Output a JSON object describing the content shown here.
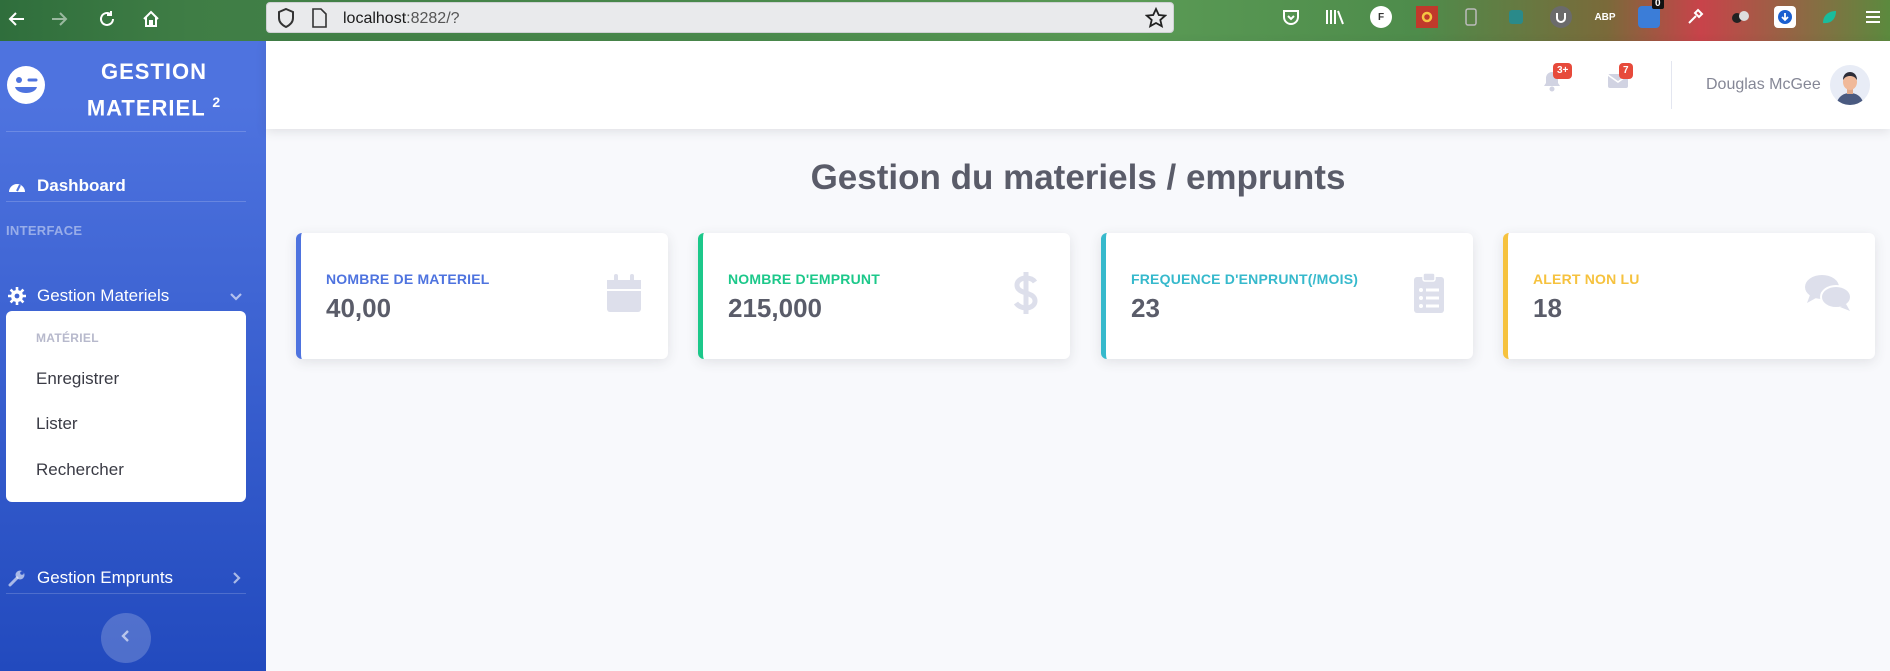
{
  "browser": {
    "url_host": "localhost",
    "url_rest": ":8282/?",
    "ext_abp": "ABP",
    "ext_f": "F",
    "ext_badge": "0"
  },
  "sidebar": {
    "brand_line1": "GESTION",
    "brand_line2": "MATERIEL",
    "brand_sup": "2",
    "dashboard_label": "Dashboard",
    "heading": "INTERFACE",
    "gestion_materiels_label": "Gestion Materiels",
    "collapse": {
      "header": "MATÉRIEL",
      "items": [
        "Enregistrer",
        "Lister",
        "Rechercher"
      ]
    },
    "gestion_emprunts_label": "Gestion Emprunts"
  },
  "topbar": {
    "alerts_badge": "3+",
    "messages_badge": "7",
    "user_name": "Douglas McGee"
  },
  "main": {
    "title": "Gestion du materiels / emprunts",
    "cards": [
      {
        "label": "NOMBRE DE MATERIEL",
        "value": "40,00",
        "color": "#4e73df",
        "icon": "calendar-icon"
      },
      {
        "label": "NOMBRE D'EMPRUNT",
        "value": "215,000",
        "color": "#1cc88a",
        "icon": "dollar-icon"
      },
      {
        "label": "FREQUENCE D'ENPRUNT(/MOIS)",
        "value": "23",
        "color": "#36b9cc",
        "icon": "clipboard-list-icon"
      },
      {
        "label": "ALERT NON LU",
        "value": "18",
        "color": "#f6c23e",
        "icon": "comments-icon"
      }
    ]
  }
}
